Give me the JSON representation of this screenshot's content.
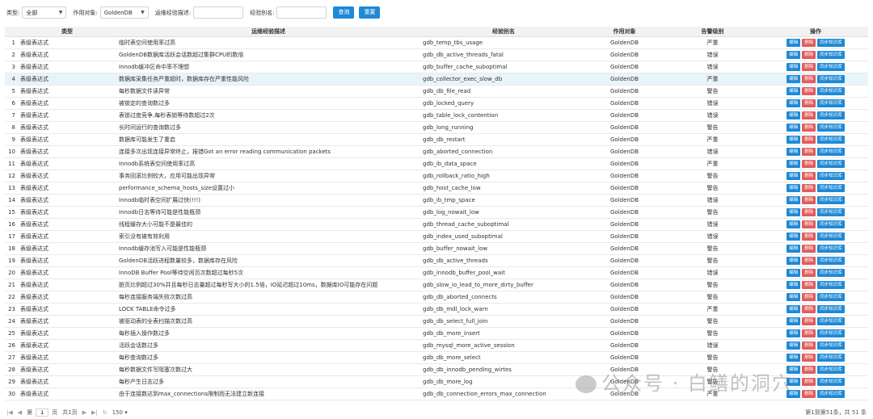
{
  "filters": {
    "type_label": "类型:",
    "type_value": "全部",
    "target_label": "作用对象:",
    "target_value": "GoldenDB",
    "desc_label": "运维经验描述:",
    "desc_value": "",
    "alias_label": "经验别名:",
    "alias_value": "",
    "query_label": "查询",
    "reset_label": "重置"
  },
  "table": {
    "columns": [
      "类型",
      "运维经验描述",
      "经验别名",
      "作用对象",
      "告警级别",
      "操作"
    ],
    "action_labels": {
      "edit": "编辑",
      "delete": "删除",
      "sync": "同步知识库"
    },
    "rows": [
      {
        "n": "1",
        "type": "表级表达式",
        "desc": "临时表空间使用率过高",
        "alias": "gdb_temp_tbs_usage",
        "target": "GoldenDB",
        "level": "严重"
      },
      {
        "n": "2",
        "type": "表级表达式",
        "desc": "GoldenDB数据库活跃会话数超过集群CPU的数倍",
        "alias": "gdb_db_active_threads_fatal",
        "target": "GoldenDB",
        "level": "错误"
      },
      {
        "n": "3",
        "type": "表级表达式",
        "desc": "Innodb缓冲区命中率不理想",
        "alias": "gdb_buffer_cache_suboptimal",
        "target": "GoldenDB",
        "level": "错误"
      },
      {
        "n": "4",
        "type": "表级表达式",
        "desc": "数据库采集任务严重超时，数据库存在严重性能风险",
        "alias": "gdb_collector_exec_slow_db",
        "target": "GoldenDB",
        "level": "严重"
      },
      {
        "n": "5",
        "type": "表级表达式",
        "desc": "每秒数据文件读异常",
        "alias": "gdb_db_file_read",
        "target": "GoldenDB",
        "level": "警告"
      },
      {
        "n": "6",
        "type": "表级表达式",
        "desc": "被锁定的查询数过多",
        "alias": "gdb_locked_query",
        "target": "GoldenDB",
        "level": "错误"
      },
      {
        "n": "7",
        "type": "表级表达式",
        "desc": "表锁过度竞争,每秒表锁等待数超过2次",
        "alias": "gdb_table_lock_contention",
        "target": "GoldenDB",
        "level": "错误"
      },
      {
        "n": "8",
        "type": "表级表达式",
        "desc": "长时间运行的查询数过多",
        "alias": "gdb_long_running",
        "target": "GoldenDB",
        "level": "警告"
      },
      {
        "n": "9",
        "type": "表级表达式",
        "desc": "数据库可能发生了重启",
        "alias": "gdb_db_restart",
        "target": "GoldenDB",
        "level": "严重"
      },
      {
        "n": "10",
        "type": "表级表达式",
        "desc": "连接多次出现连接异常终止，报错Got an error reading communication packets",
        "alias": "gdb_aborted_connection",
        "target": "GoldenDB",
        "level": "错误"
      },
      {
        "n": "11",
        "type": "表级表达式",
        "desc": "Innodb系统表空间使用率过高",
        "alias": "gdb_ib_data_space",
        "target": "GoldenDB",
        "level": "严重"
      },
      {
        "n": "12",
        "type": "表级表达式",
        "desc": "事务回滚比例较大，应用可能出现异常",
        "alias": "gdb_rollback_ratio_high",
        "target": "GoldenDB",
        "level": "警告"
      },
      {
        "n": "13",
        "type": "表级表达式",
        "desc": "performance_schema_hosts_size设置过小",
        "alias": "gdb_host_cache_low",
        "target": "GoldenDB",
        "level": "警告"
      },
      {
        "n": "14",
        "type": "表级表达式",
        "desc": "Innodb临时表空间扩展过快(!!!)",
        "alias": "gdb_ib_tmp_space",
        "target": "GoldenDB",
        "level": "错误"
      },
      {
        "n": "15",
        "type": "表级表达式",
        "desc": "Innodb日志等待可能是性能瓶颈",
        "alias": "gdb_log_nowait_low",
        "target": "GoldenDB",
        "level": "警告"
      },
      {
        "n": "16",
        "type": "表级表达式",
        "desc": "线程缓存大小可能不是最佳的",
        "alias": "gdb_thread_cache_suboptimal",
        "target": "GoldenDB",
        "level": "错误"
      },
      {
        "n": "17",
        "type": "表级表达式",
        "desc": "索引没有被有效利用",
        "alias": "gdb_index_used_suboptimal",
        "target": "GoldenDB",
        "level": "错误"
      },
      {
        "n": "18",
        "type": "表级表达式",
        "desc": "Innodb缓存池写入可能是性能瓶颈",
        "alias": "gdb_buffer_nowait_low",
        "target": "GoldenDB",
        "level": "警告"
      },
      {
        "n": "19",
        "type": "表级表达式",
        "desc": "GoldenDB活跃进程数量较多，数据库存在风险",
        "alias": "gdb_db_active_threads",
        "target": "GoldenDB",
        "level": "警告"
      },
      {
        "n": "20",
        "type": "表级表达式",
        "desc": "InnoDB Buffer Pool等待空闲页次数超过每秒5次",
        "alias": "gdb_innodb_buffer_pool_wait",
        "target": "GoldenDB",
        "level": "错误"
      },
      {
        "n": "21",
        "type": "表级表达式",
        "desc": "脏页比例超过30%并且每秒日志量超过每秒写大小的1.5倍，IO延迟超过10ms，数据库IO可能存在问题",
        "alias": "gdb_slow_io_lead_to_more_dirty_buffer",
        "target": "GoldenDB",
        "level": "警告"
      },
      {
        "n": "22",
        "type": "表级表达式",
        "desc": "每秒连接服务端失败次数过高",
        "alias": "gdb_db_aborted_connects",
        "target": "GoldenDB",
        "level": "警告"
      },
      {
        "n": "23",
        "type": "表级表达式",
        "desc": "LOCK TABLE命令过多",
        "alias": "gdb_db_mdl_lock_warn",
        "target": "GoldenDB",
        "level": "严重"
      },
      {
        "n": "24",
        "type": "表级表达式",
        "desc": "被驱动表的全表扫描次数过高",
        "alias": "gdb_db_select_full_join",
        "target": "GoldenDB",
        "level": "警告"
      },
      {
        "n": "25",
        "type": "表级表达式",
        "desc": "每秒插入操作数过多",
        "alias": "gdb_db_more_insert",
        "target": "GoldenDB",
        "level": "警告"
      },
      {
        "n": "26",
        "type": "表级表达式",
        "desc": "活跃会话数过多",
        "alias": "gdb_mysql_more_active_session",
        "target": "GoldenDB",
        "level": "错误"
      },
      {
        "n": "27",
        "type": "表级表达式",
        "desc": "每秒查询数过多",
        "alias": "gdb_db_more_select",
        "target": "GoldenDB",
        "level": "警告"
      },
      {
        "n": "28",
        "type": "表级表达式",
        "desc": "每秒数据文件写阻塞次数过大",
        "alias": "gdb_db_innodb_pending_wirtes",
        "target": "GoldenDB",
        "level": "警告"
      },
      {
        "n": "29",
        "type": "表级表达式",
        "desc": "每秒产生日志过多",
        "alias": "gdb_db_more_log",
        "target": "GoldenDB",
        "level": "警告"
      },
      {
        "n": "30",
        "type": "表级表达式",
        "desc": "由于连接数达到max_connections限制而无法建立新连接",
        "alias": "gdb_db_connection_errors_max_connection",
        "target": "GoldenDB",
        "level": "严重"
      }
    ]
  },
  "pager": {
    "page_prefix": "第",
    "page_value": "1",
    "page_suffix": "页",
    "total_pages": "共1页",
    "page_size": "150",
    "summary": "第1到第51条，共 51 条"
  },
  "watermark": {
    "text": "公众号 · 白鳝的洞穴"
  }
}
